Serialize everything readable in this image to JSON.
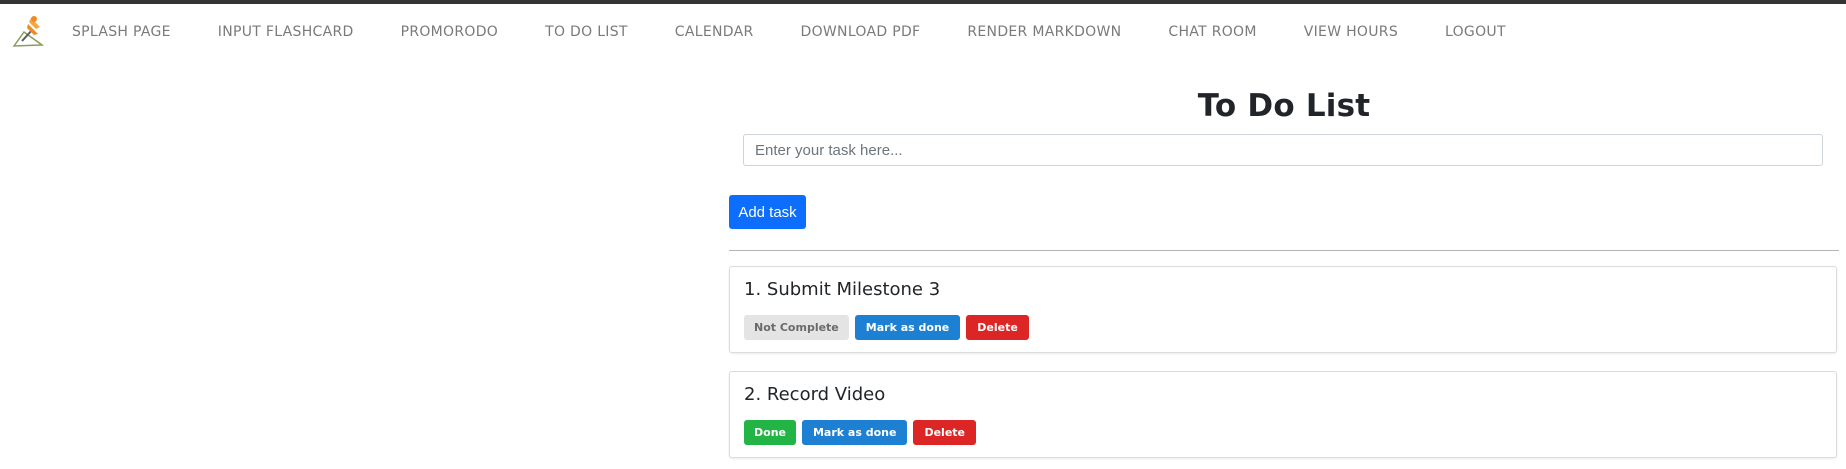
{
  "nav": {
    "items": [
      {
        "label": "SPLASH PAGE"
      },
      {
        "label": "INPUT FLASHCARD"
      },
      {
        "label": "PROMORODO"
      },
      {
        "label": "TO DO LIST"
      },
      {
        "label": "CALENDAR"
      },
      {
        "label": "DOWNLOAD PDF"
      },
      {
        "label": "RENDER MARKDOWN"
      },
      {
        "label": "CHAT ROOM"
      },
      {
        "label": "VIEW HOURS"
      },
      {
        "label": "LOGOUT"
      }
    ],
    "brand_icon": "pushpin-logo-icon"
  },
  "main": {
    "title": "To Do List",
    "task_input": {
      "value": "",
      "placeholder": "Enter your task here..."
    },
    "add_button_label": "Add task"
  },
  "tasks": [
    {
      "title": "1. Submit Milestone 3",
      "status": "Not Complete",
      "mark_label": "Mark as done",
      "delete_label": "Delete"
    },
    {
      "title": "2. Record Video",
      "status": "Done",
      "mark_label": "Mark as done",
      "delete_label": "Delete"
    }
  ],
  "colors": {
    "primary": "#0d6efd",
    "info": "#1e80d2",
    "danger": "#dc2626",
    "success": "#22b545",
    "muted_badge": "#e4e4e4",
    "nav_text": "#7a7a7a",
    "top_strip": "#343434"
  }
}
